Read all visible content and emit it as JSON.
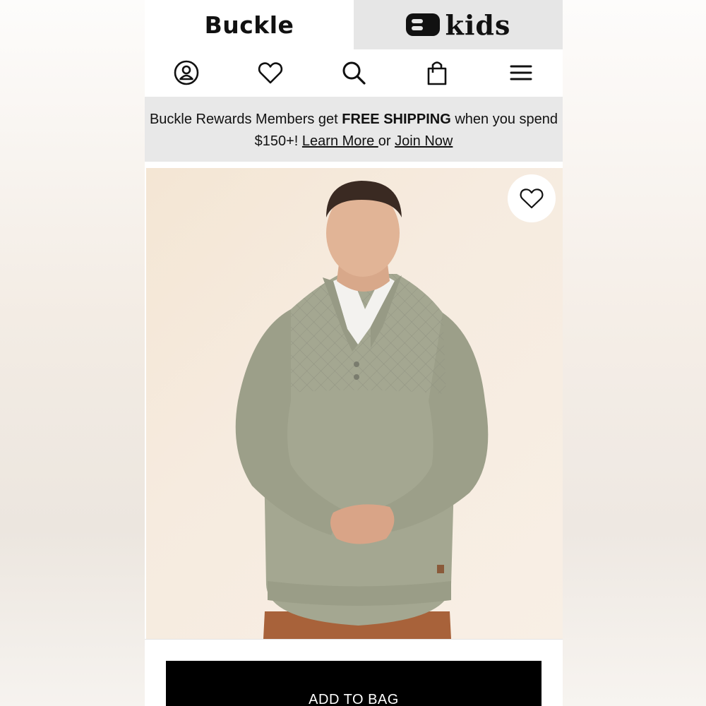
{
  "brand_tabs": {
    "buckle_label": "Buckle",
    "kids_label": "kids"
  },
  "nav_icons": [
    "account-icon",
    "wishlist-heart-icon",
    "search-icon",
    "shopping-bag-icon",
    "menu-icon"
  ],
  "promo": {
    "text_before": "Buckle Rewards Members get ",
    "highlight": "FREE SHIPPING",
    "text_after": " when you spend $150+! ",
    "learn_more": "Learn More ",
    "or": "or ",
    "join_now": "Join Now"
  },
  "product": {
    "wishlist_icon": "heart-outline-icon",
    "add_to_bag_label": "ADD TO BAG"
  },
  "colors": {
    "promo_bg": "#e8e8e8",
    "kids_tab_bg": "#e6e6e6",
    "button_bg": "#000000",
    "sweater": "#a4a791",
    "background": "#f4e6d4"
  }
}
